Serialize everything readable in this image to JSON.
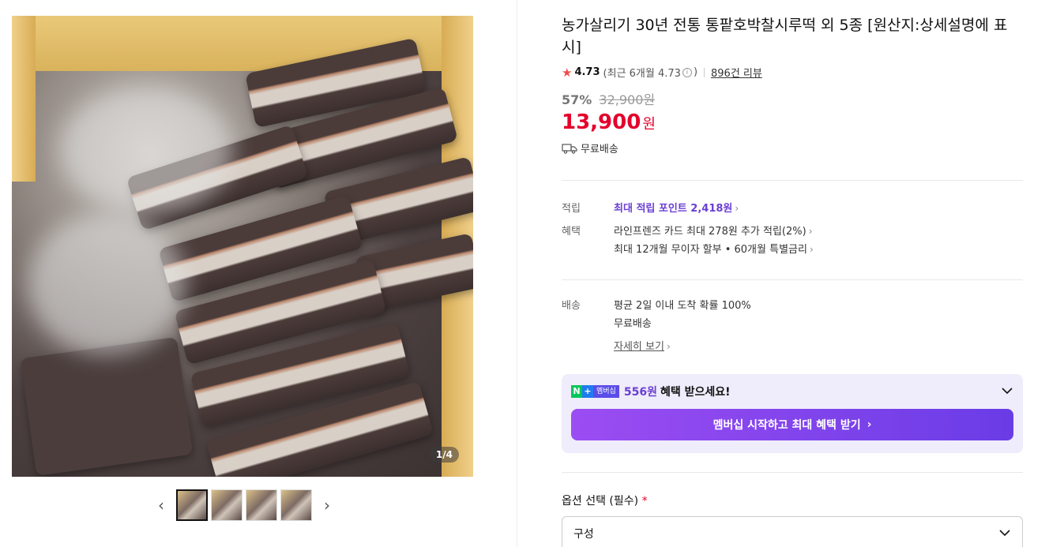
{
  "gallery": {
    "counter": "1/4",
    "thumbs": 4,
    "prev_arrow": "‹",
    "next_arrow": "›"
  },
  "product": {
    "title": "농가살리기 30년 전통 통팥호박찰시루떡 외 5종 [원산지:상세설명에 표시]",
    "rating": "4.73",
    "rating_sub_prefix": "(최근 6개월 4.73",
    "rating_sub_suffix": ")",
    "review_count": "896건 리뷰",
    "discount_rate": "57%",
    "original_price": "32,900원",
    "price": "13,900",
    "price_unit": "원",
    "shipping_label": "무료배송"
  },
  "benefits": {
    "points_label": "적립",
    "points_text": "최대 적립 포인트 2,418원",
    "perks_label": "혜택",
    "perk_1": "라인프렌즈 카드 최대 278원 추가 적립(2%)",
    "perk_2": "최대 12개월 무이자 할부 • 60개월 특별금리",
    "delivery_label": "배송",
    "delivery_1": "평균 2일 이내 도착 확률 100%",
    "delivery_2": "무료배송",
    "detail_link": "자세히 보기"
  },
  "membership": {
    "badge_n": "N",
    "badge_plus": "+",
    "badge_text": "멤버십",
    "amount": "556원",
    "text": "혜택 받으세요!",
    "button": "멤버십 시작하고 최대 혜택 받기"
  },
  "options": {
    "label": "옵션 선택 (필수)",
    "required_mark": "*",
    "select_value": "구성"
  },
  "colors": {
    "price_red": "#e4002b",
    "accent_purple": "#6b3fd4",
    "membership_bg": "#efecfb"
  },
  "icons": [
    "star-icon",
    "info-icon",
    "truck-icon",
    "chevron-right-icon",
    "chevron-down-icon",
    "prev-arrow-icon",
    "next-arrow-icon"
  ]
}
